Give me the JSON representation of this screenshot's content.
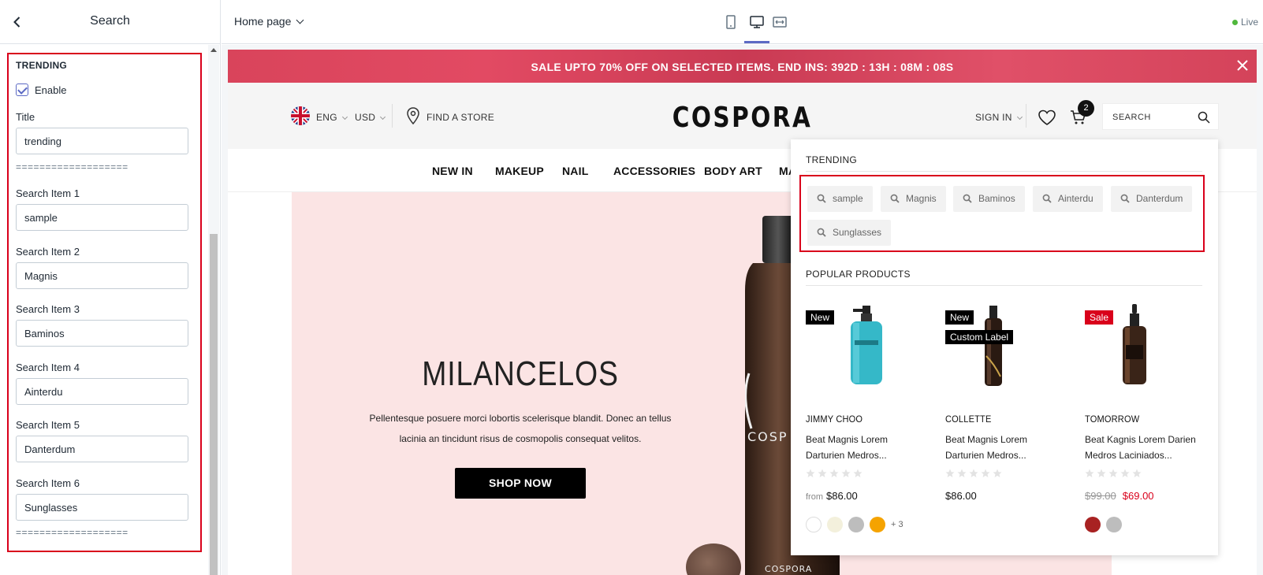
{
  "sidebar": {
    "title": "Search",
    "section_title": "TRENDING",
    "enable_label": "Enable",
    "title_label": "Title",
    "title_value": "trending",
    "divider": "===================",
    "items": [
      {
        "label": "Search Item 1",
        "value": "sample"
      },
      {
        "label": "Search Item 2",
        "value": "Magnis"
      },
      {
        "label": "Search Item 3",
        "value": "Baminos"
      },
      {
        "label": "Search Item 4",
        "value": "Ainterdu"
      },
      {
        "label": "Search Item 5",
        "value": "Danterdum"
      },
      {
        "label": "Search Item 6",
        "value": "Sunglasses"
      }
    ]
  },
  "topbar": {
    "page_selector": "Home page",
    "live_label": "Live"
  },
  "store": {
    "announcement": "SALE UPTO 70% OFF ON SELECTED ITEMS. END INS: 392D : 13H : 08M : 08S",
    "language": "ENG",
    "currency": "USD",
    "find_store": "FIND A STORE",
    "logo": "COSPORA",
    "sign_in": "SIGN IN",
    "cart_count": "2",
    "search_placeholder": "SEARCH",
    "nav": [
      "NEW IN",
      "MAKEUP",
      "NAIL",
      "ACCESSORIES",
      "BODY ART",
      "MA"
    ],
    "hero": {
      "title": "MILANCELOS",
      "description": "Pellentesque posuere morci lobortis scelerisque blandit. Donec an tellus lacinia an tincidunt risus de cosmopolis consequat velitos.",
      "button": "SHOP NOW",
      "bottle_brand": "COSP",
      "bottle_label": "COSPORA"
    }
  },
  "dropdown": {
    "trending_title": "TRENDING",
    "chips": [
      "sample",
      "Magnis",
      "Baminos",
      "Ainterdu",
      "Danterdum",
      "Sunglasses"
    ],
    "popular_title": "POPULAR PRODUCTS",
    "products": [
      {
        "badges": [
          "New"
        ],
        "vendor": "JIMMY CHOO",
        "title": "Beat Magnis Lorem Darturien Medros...",
        "price_prefix": "from",
        "price": "$86.00",
        "old_price": "",
        "swatches": [
          "#ffffff",
          "#f3f0dc",
          "#bdbdbd",
          "#f5a300"
        ],
        "more_swatches": "+ 3"
      },
      {
        "badges": [
          "New",
          "Custom Label"
        ],
        "vendor": "COLLETTE",
        "title": "Beat Magnis Lorem Darturien Medros...",
        "price_prefix": "",
        "price": "$86.00",
        "old_price": "",
        "swatches": [],
        "more_swatches": ""
      },
      {
        "badges": [
          "Sale"
        ],
        "vendor": "TOMORROW",
        "title": "Beat Kagnis Lorem Darien Medros Laciniados...",
        "price_prefix": "",
        "price": "$69.00",
        "old_price": "$99.00",
        "swatches": [
          "#a82222",
          "#bdbdbd"
        ],
        "more_swatches": ""
      }
    ]
  },
  "colors": {
    "accent": "#5c6ac4",
    "highlight_border": "#d9001b",
    "sale_bar": "#d9445b",
    "hero_bg": "#fbe4e4",
    "sale_badge": "#d9001b"
  }
}
